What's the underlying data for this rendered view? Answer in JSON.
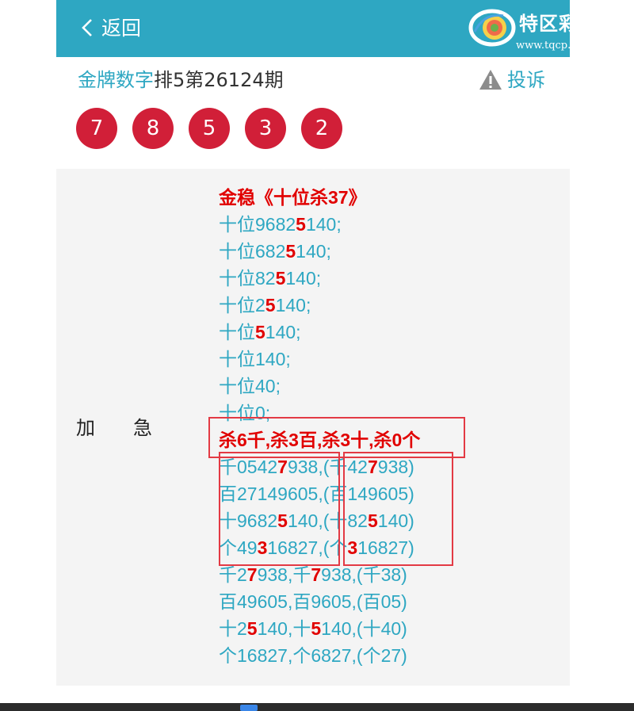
{
  "header": {
    "back_label": "返回",
    "logo_text": "特区彩票网",
    "logo_url": "www.tqcp.net"
  },
  "title": {
    "accent": "金牌数字",
    "rest": "排5第26124期"
  },
  "complaint_label": "投诉",
  "numbers": [
    "7",
    "8",
    "5",
    "3",
    "2"
  ],
  "side_label": "加　　急",
  "lines": [
    {
      "head": true,
      "parts": [
        [
          "金稳《十位杀37》",
          false
        ]
      ]
    },
    {
      "parts": [
        [
          "十位9682",
          false
        ],
        [
          "5",
          true
        ],
        [
          "140;",
          false
        ]
      ]
    },
    {
      "parts": [
        [
          "十位682",
          false
        ],
        [
          "5",
          true
        ],
        [
          "140;",
          false
        ]
      ]
    },
    {
      "parts": [
        [
          "十位82",
          false
        ],
        [
          "5",
          true
        ],
        [
          "140;",
          false
        ]
      ]
    },
    {
      "parts": [
        [
          "十位2",
          false
        ],
        [
          "5",
          true
        ],
        [
          "140;",
          false
        ]
      ]
    },
    {
      "parts": [
        [
          "十位",
          false
        ],
        [
          "5",
          true
        ],
        [
          "140;",
          false
        ]
      ]
    },
    {
      "parts": [
        [
          "十位140;",
          false
        ]
      ]
    },
    {
      "parts": [
        [
          "十位40;",
          false
        ]
      ]
    },
    {
      "parts": [
        [
          "十位0;",
          false
        ]
      ]
    },
    {
      "head": true,
      "parts": [
        [
          "杀6千,杀3百,杀3十,杀0个",
          false
        ]
      ]
    },
    {
      "parts": [
        [
          "千0542",
          false
        ],
        [
          "7",
          true
        ],
        [
          "938,(千42",
          false
        ],
        [
          "7",
          true
        ],
        [
          "938)",
          false
        ]
      ]
    },
    {
      "parts": [
        [
          "百27149605,(百149605)",
          false
        ]
      ]
    },
    {
      "parts": [
        [
          "十9682",
          false
        ],
        [
          "5",
          true
        ],
        [
          "140,(十82",
          false
        ],
        [
          "5",
          true
        ],
        [
          "140)",
          false
        ]
      ]
    },
    {
      "parts": [
        [
          "个49",
          false
        ],
        [
          "3",
          true
        ],
        [
          "16827,(个",
          false
        ],
        [
          "3",
          true
        ],
        [
          "16827)",
          false
        ]
      ]
    },
    {
      "parts": [
        [
          "千2",
          false
        ],
        [
          "7",
          true
        ],
        [
          "938,千",
          false
        ],
        [
          "7",
          true
        ],
        [
          "938,(千38)",
          false
        ]
      ]
    },
    {
      "parts": [
        [
          "百49605,百9605,(百05)",
          false
        ]
      ]
    },
    {
      "parts": [
        [
          "十2",
          false
        ],
        [
          "5",
          true
        ],
        [
          "140,十",
          false
        ],
        [
          "5",
          true
        ],
        [
          "140,(十40)",
          false
        ]
      ]
    },
    {
      "parts": [
        [
          "个16827,个6827,(个27)",
          false
        ]
      ]
    }
  ],
  "colors": {
    "brand": "#2ea7c2",
    "ball": "#d11f38",
    "highlight": "#e10000",
    "box": "#e33a44"
  }
}
